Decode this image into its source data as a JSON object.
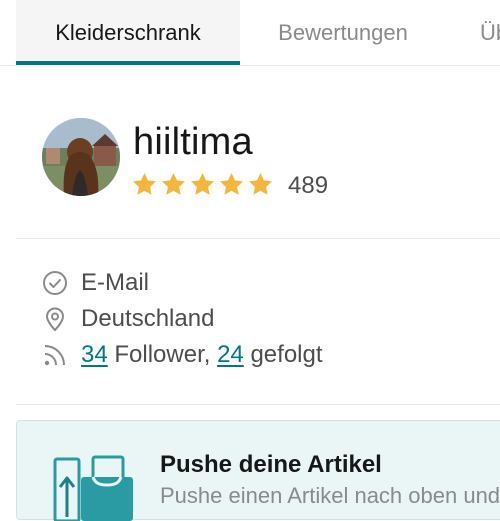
{
  "tabs": [
    {
      "label": "Kleiderschrank",
      "active": true
    },
    {
      "label": "Bewertungen",
      "active": false
    },
    {
      "label": "Üb",
      "active": false
    }
  ],
  "profile": {
    "username": "hiiltima",
    "rating_stars": 5,
    "rating_count": "489",
    "avatar_icon": "user-photo"
  },
  "info": {
    "email_label": "E-Mail",
    "email_icon": "check-circle-icon",
    "location": "Deutschland",
    "location_icon": "map-pin-icon",
    "followers_count": "34",
    "followers_text": " Follower, ",
    "following_count": "24",
    "following_text": " gefolgt",
    "feed_icon": "rss-icon"
  },
  "promo": {
    "title": "Pushe deine Artikel",
    "subtitle": "Pushe einen Artikel nach oben und"
  },
  "colors": {
    "accent": "#007782",
    "star": "#f5b73b",
    "promo_bg": "#eaf6f6"
  }
}
